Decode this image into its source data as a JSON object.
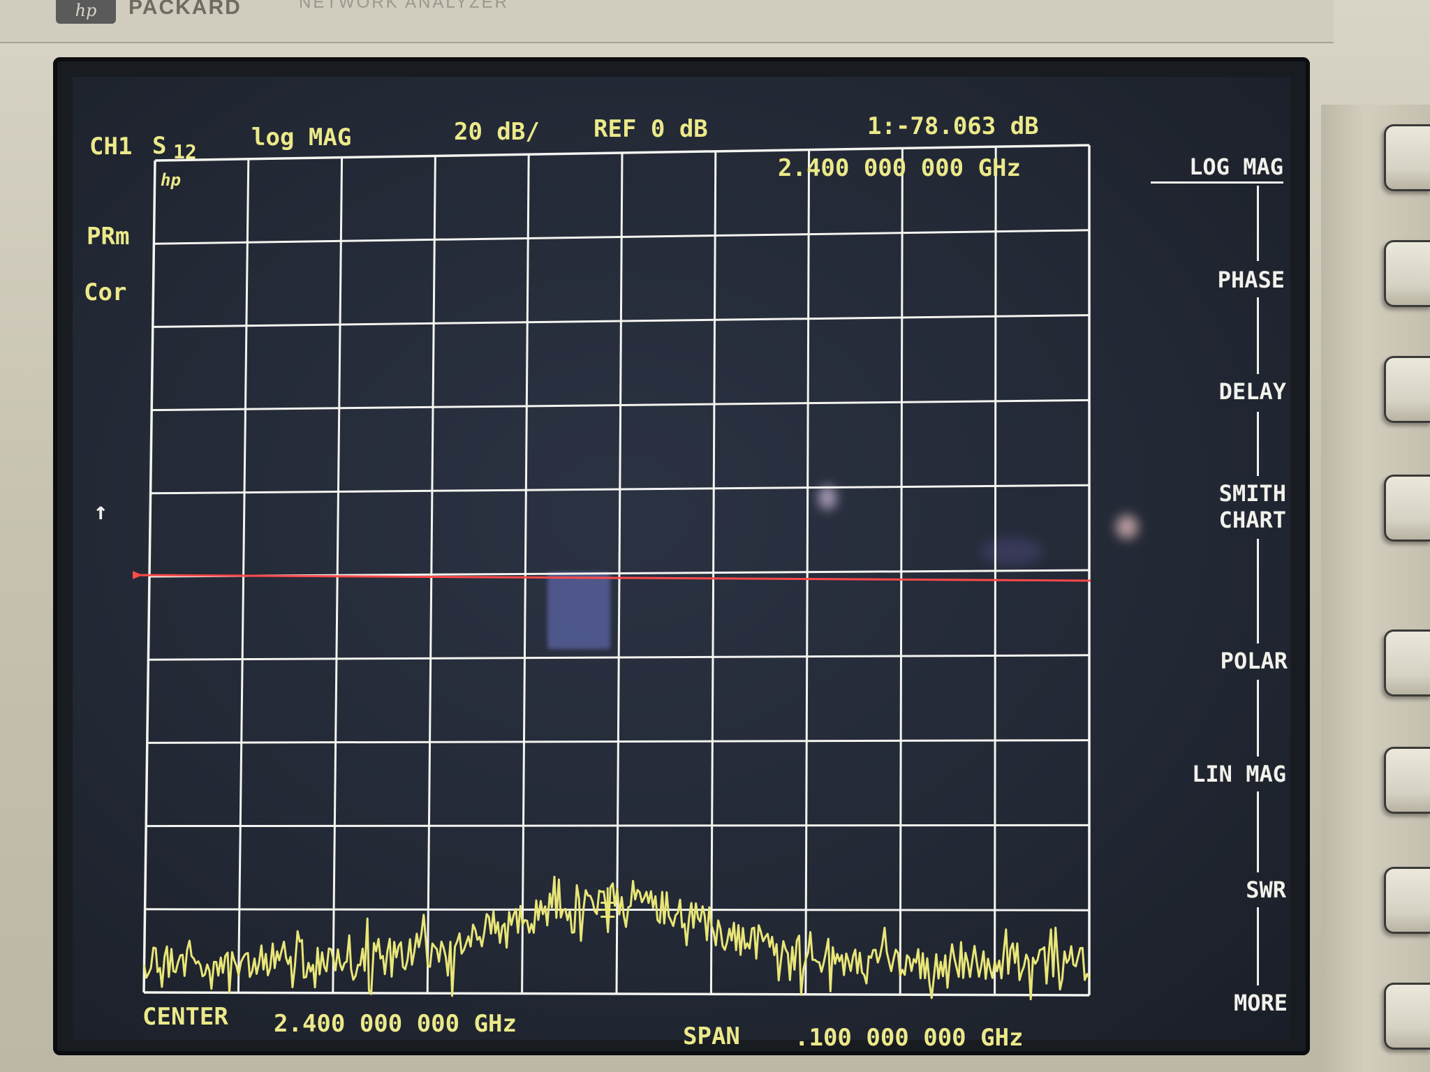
{
  "brand": {
    "logo_text": "hp",
    "name": "PACKARD",
    "model": "NETWORK  ANALYZER"
  },
  "header": {
    "channel": "CH1",
    "param": "S",
    "param_sub": "12",
    "format": "log MAG",
    "scale": "20 dB/",
    "reference": "REF 0 dB",
    "marker_value": "1:-78.063 dB",
    "marker_freq": "2.400 000 000 GHz"
  },
  "annotations": {
    "prm": "PRm",
    "cor": "Cor",
    "ref_arrow": "↑",
    "hp_mark": "hp"
  },
  "footer": {
    "center_label": "CENTER",
    "center_freq": "2.400 000 000 GHz",
    "span_label": "SPAN",
    "span_freq": ".100 000 000 GHz"
  },
  "softkeys": [
    "LOG MAG",
    "PHASE",
    "DELAY",
    "SMITH\nCHART",
    "POLAR",
    "LIN MAG",
    "SWR",
    "MORE"
  ],
  "colors": {
    "trace": "#e9e678",
    "reference_line": "#ff4a4a",
    "grid": "#f4f4f0",
    "annotation_text": "#ece98a",
    "softkey_text": "#f2f2ec"
  },
  "trace": {
    "reference_level_db": 0,
    "scale_db_per_div": 20,
    "divisions": 10,
    "marker_db": -78.063
  }
}
